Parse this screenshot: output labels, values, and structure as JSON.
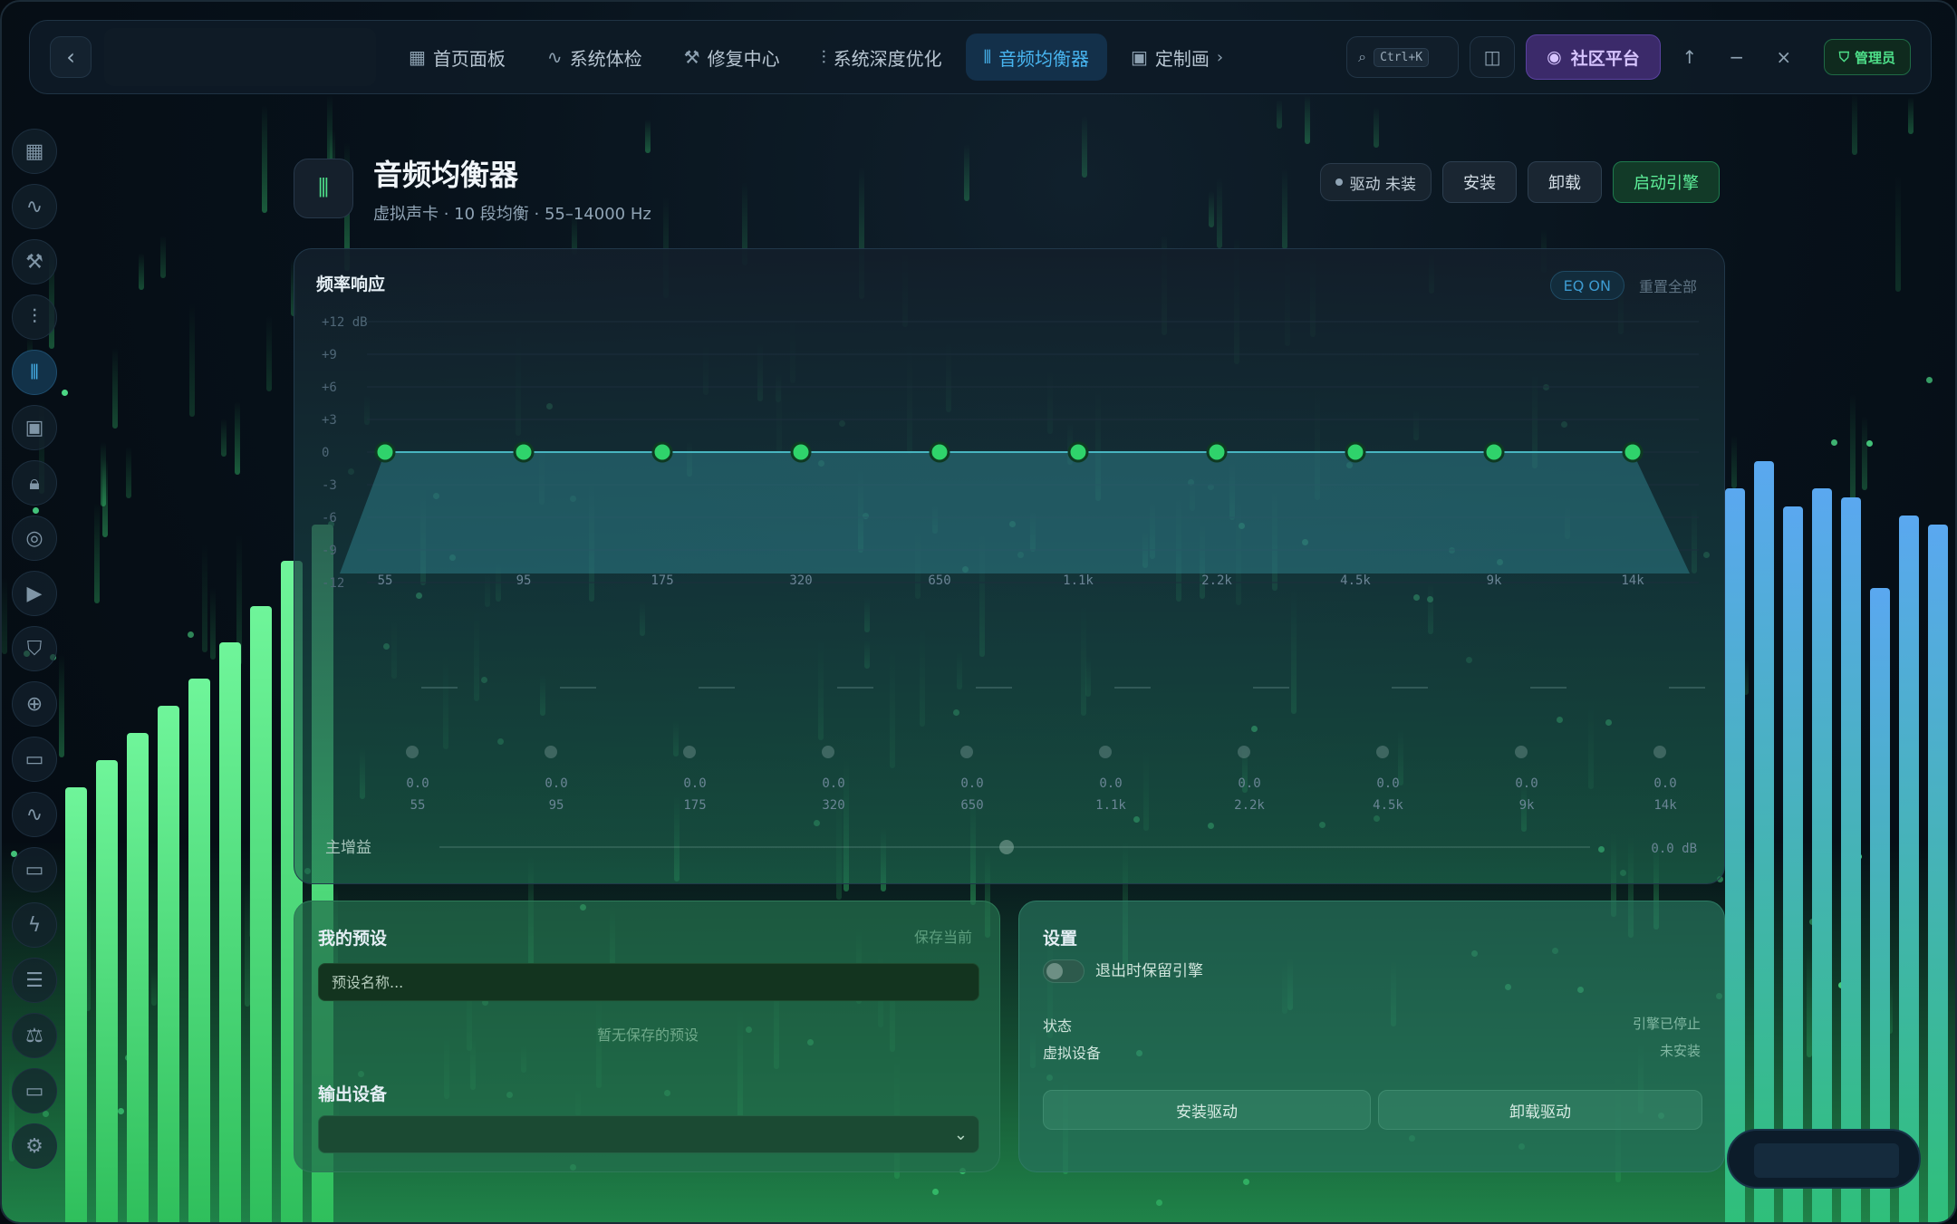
{
  "titlebar": {
    "nav": [
      {
        "label": "首页面板",
        "icon": "grid-icon",
        "active": false
      },
      {
        "label": "系统体检",
        "icon": "pulse-icon",
        "active": false
      },
      {
        "label": "修复中心",
        "icon": "wrench-icon",
        "active": false
      },
      {
        "label": "系统深度优化",
        "icon": "sliders-icon",
        "active": false
      },
      {
        "label": "音频均衡器",
        "icon": "waveform-icon",
        "active": true
      },
      {
        "label": "定制画",
        "icon": "image-icon",
        "active": false
      }
    ],
    "search_shortcut": "Ctrl+K",
    "community_label": "社区平台",
    "admin_label": "管理员"
  },
  "sidebar": {
    "icons": [
      "grid-icon",
      "pulse-icon",
      "wrench-icon",
      "sliders-icon",
      "waveform-icon",
      "image-icon",
      "lock-icon",
      "target-icon",
      "camera-icon",
      "shield-icon",
      "globe-icon",
      "monitor-icon",
      "pulse-icon",
      "display-icon",
      "bolt-icon",
      "list-icon",
      "scale-icon",
      "screen-icon",
      "gear-icon"
    ],
    "active_index": 4
  },
  "header": {
    "title": "音频均衡器",
    "subtitle": "虚拟声卡 · 10 段均衡 · 55–14000 Hz",
    "driver_status": "驱动 未装",
    "install_label": "安装",
    "uninstall_label": "卸载",
    "start_label": "启动引擎"
  },
  "freq": {
    "title": "频率响应",
    "eq_on": "EQ ON",
    "reset_all": "重置全部",
    "db_ticks": [
      "+12 dB",
      "+9",
      "+6",
      "+3",
      "0",
      "-3",
      "-6",
      "-9",
      "-12"
    ],
    "bands": [
      "55",
      "95",
      "175",
      "320",
      "650",
      "1.1k",
      "2.2k",
      "4.5k",
      "9k",
      "14k"
    ],
    "gains": [
      0,
      0,
      0,
      0,
      0,
      0,
      0,
      0,
      0,
      0
    ],
    "slider_values": [
      "0.0",
      "0.0",
      "0.0",
      "0.0",
      "0.0",
      "0.0",
      "0.0",
      "0.0",
      "0.0",
      "0.0"
    ],
    "master_label": "主增益",
    "master_value": "0.0 dB"
  },
  "presets": {
    "title": "我的预设",
    "save_current": "保存当前",
    "name_placeholder": "预设名称...",
    "empty_note": "暂无保存的预设",
    "output_title": "输出设备",
    "output_chevron": "⌄"
  },
  "settings": {
    "title": "设置",
    "keep_engine_label": "退出时保留引擎",
    "status_key": "状态",
    "status_value": "引擎已停止",
    "device_key": "虚拟设备",
    "device_value": "未安装",
    "install_driver": "安装驱动",
    "uninstall_driver": "卸载驱动"
  },
  "colors": {
    "accent_blue": "#48b5f0",
    "accent_green": "#4ee08a",
    "community_purple": "#3b2a6a"
  }
}
